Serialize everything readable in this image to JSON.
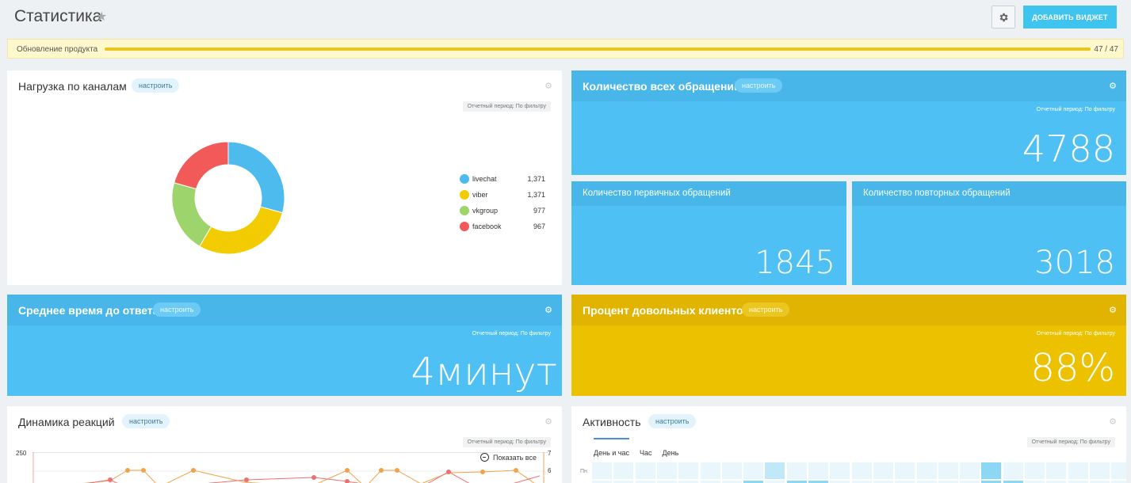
{
  "header": {
    "title": "Статистика",
    "add_widget_label": "ДОБАВИТЬ ВИДЖЕТ"
  },
  "update": {
    "label": "Обновление продукта",
    "count": "47 / 47",
    "progress": 1.0
  },
  "widgets": {
    "channels": {
      "title": "Нагрузка по каналам",
      "configure": "настроить",
      "period": "Отчетный период: По фильтру",
      "chart_data": {
        "type": "pie",
        "categories": [
          "livechat",
          "viber",
          "vkgroup",
          "facebook"
        ],
        "values": [
          1371,
          1371,
          977,
          967
        ],
        "value_labels": [
          "1,371",
          "1,371",
          "977",
          "967"
        ],
        "colors": [
          "#4dbbee",
          "#f2cc00",
          "#9dd46b",
          "#f25a5a"
        ]
      }
    },
    "total": {
      "title": "Количество всех обращений",
      "configure": "настроить",
      "period": "Отчетный период: По фильтру",
      "value": "4788"
    },
    "primary": {
      "title": "Количество первичных обращений",
      "value": "1845"
    },
    "repeat": {
      "title": "Количество повторных обращений",
      "value": "3018"
    },
    "avg_time": {
      "title": "Среднее время до ответа",
      "configure": "настроить",
      "period": "Отчетный период: По фильтру",
      "value": "4минут"
    },
    "satisfaction": {
      "title": "Процент довольных клиентов",
      "configure": "настроить",
      "period": "Отчетный период: По фильтру",
      "value": "88%"
    },
    "dynamics": {
      "title": "Динамика реакций",
      "configure": "настроить",
      "period": "Отчетный период: По фильтру",
      "zoom_label": "Показать все",
      "y_left_top": "250",
      "y_right_ticks": [
        "7",
        "6"
      ]
    },
    "activity": {
      "title": "Активность",
      "configure": "настроить",
      "period": "Отчетный период: По фильтру",
      "tabs": [
        "День и час",
        "Час",
        "День"
      ],
      "row_label": "Пн"
    }
  }
}
